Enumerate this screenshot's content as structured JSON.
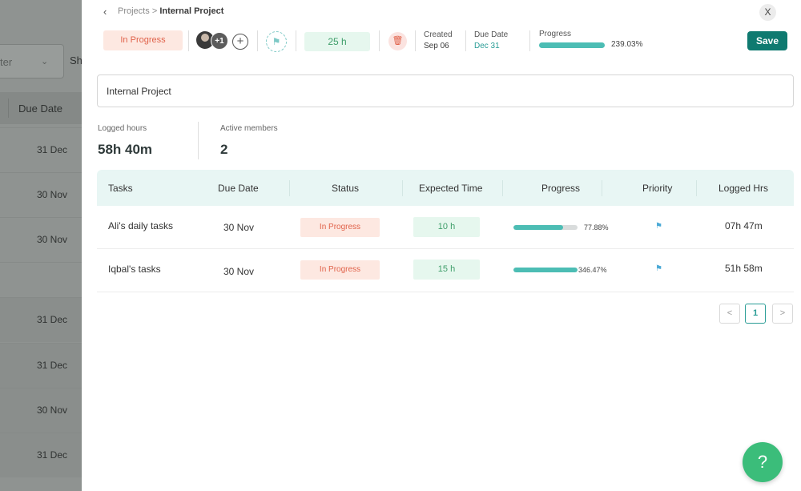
{
  "background": {
    "filter_text": "ter",
    "show_text": "Sh",
    "header_label": "Due Date",
    "rows": [
      "31 Dec",
      "30 Nov",
      "30 Nov",
      "",
      "31 Dec",
      "31 Dec",
      "30 Nov",
      "31 Dec"
    ]
  },
  "breadcrumb": {
    "parent": "Projects",
    "separator": ">",
    "current": "Internal Project"
  },
  "close_label": "X",
  "project": {
    "status": "In Progress",
    "extra_members": "+1",
    "estimated_hours": "25 h",
    "created_label": "Created",
    "created_value": "Sep 06",
    "due_label": "Due Date",
    "due_value": "Dec 31",
    "progress_label": "Progress",
    "progress_value": "239.03%",
    "save_label": "Save",
    "name": "Internal Project"
  },
  "stats": {
    "logged_hours_label": "Logged hours",
    "logged_hours_value": "58h 40m",
    "active_members_label": "Active members",
    "active_members_value": "2"
  },
  "table": {
    "headers": [
      "Tasks",
      "Due Date",
      "Status",
      "Expected Time",
      "Progress",
      "Priority",
      "Logged Hrs"
    ],
    "rows": [
      {
        "task": "Ali's daily tasks",
        "due": "30 Nov",
        "status": "In Progress",
        "expected": "10 h",
        "progress": "77.88%",
        "progress_fraction": 0.7788,
        "logged": "07h 47m"
      },
      {
        "task": "Iqbal's tasks",
        "due": "30 Nov",
        "status": "In Progress",
        "expected": "15 h",
        "progress": "346.47%",
        "progress_fraction": 1.0,
        "logged": "51h 58m"
      }
    ]
  },
  "pagination": {
    "prev": "<",
    "current": "1",
    "next": ">"
  },
  "help_label": "?",
  "colors": {
    "accent": "#0f7a70",
    "teal": "#4cbdb4",
    "status_bg": "#fde8e1",
    "status_text": "#e0624a",
    "hours_bg": "#e6f7ee",
    "help": "#3bbd7a"
  }
}
